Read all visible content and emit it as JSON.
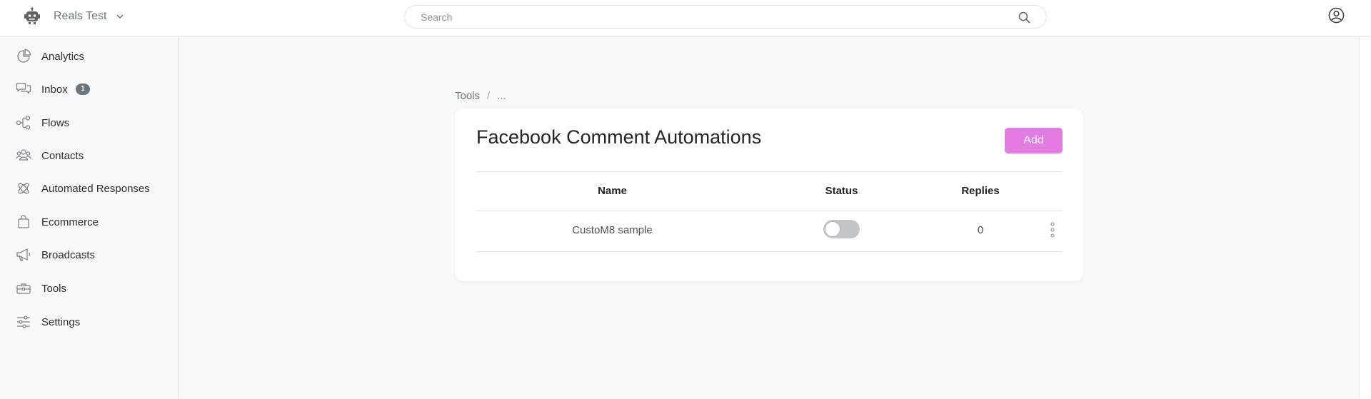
{
  "header": {
    "workspace_name": "Reals Test",
    "search_placeholder": "Search"
  },
  "sidebar": {
    "items": [
      {
        "label": "Analytics",
        "icon": "analytics-icon"
      },
      {
        "label": "Inbox",
        "icon": "inbox-icon",
        "badge": "1"
      },
      {
        "label": "Flows",
        "icon": "flows-icon"
      },
      {
        "label": "Contacts",
        "icon": "contacts-icon"
      },
      {
        "label": "Automated Responses",
        "icon": "automated-responses-icon"
      },
      {
        "label": "Ecommerce",
        "icon": "shopping-bag-icon"
      },
      {
        "label": "Broadcasts",
        "icon": "megaphone-icon"
      },
      {
        "label": "Tools",
        "icon": "toolbox-icon"
      },
      {
        "label": "Settings",
        "icon": "sliders-icon"
      }
    ]
  },
  "breadcrumb": {
    "items": [
      "Tools",
      "..."
    ],
    "separator": "/"
  },
  "main": {
    "title": "Facebook Comment Automations",
    "add_label": "Add",
    "accent_color": "#e57be4",
    "table": {
      "columns": [
        "Name",
        "Status",
        "Replies"
      ],
      "rows": [
        {
          "name": "CustoM8 sample",
          "status_enabled": false,
          "replies": "0"
        }
      ]
    }
  }
}
